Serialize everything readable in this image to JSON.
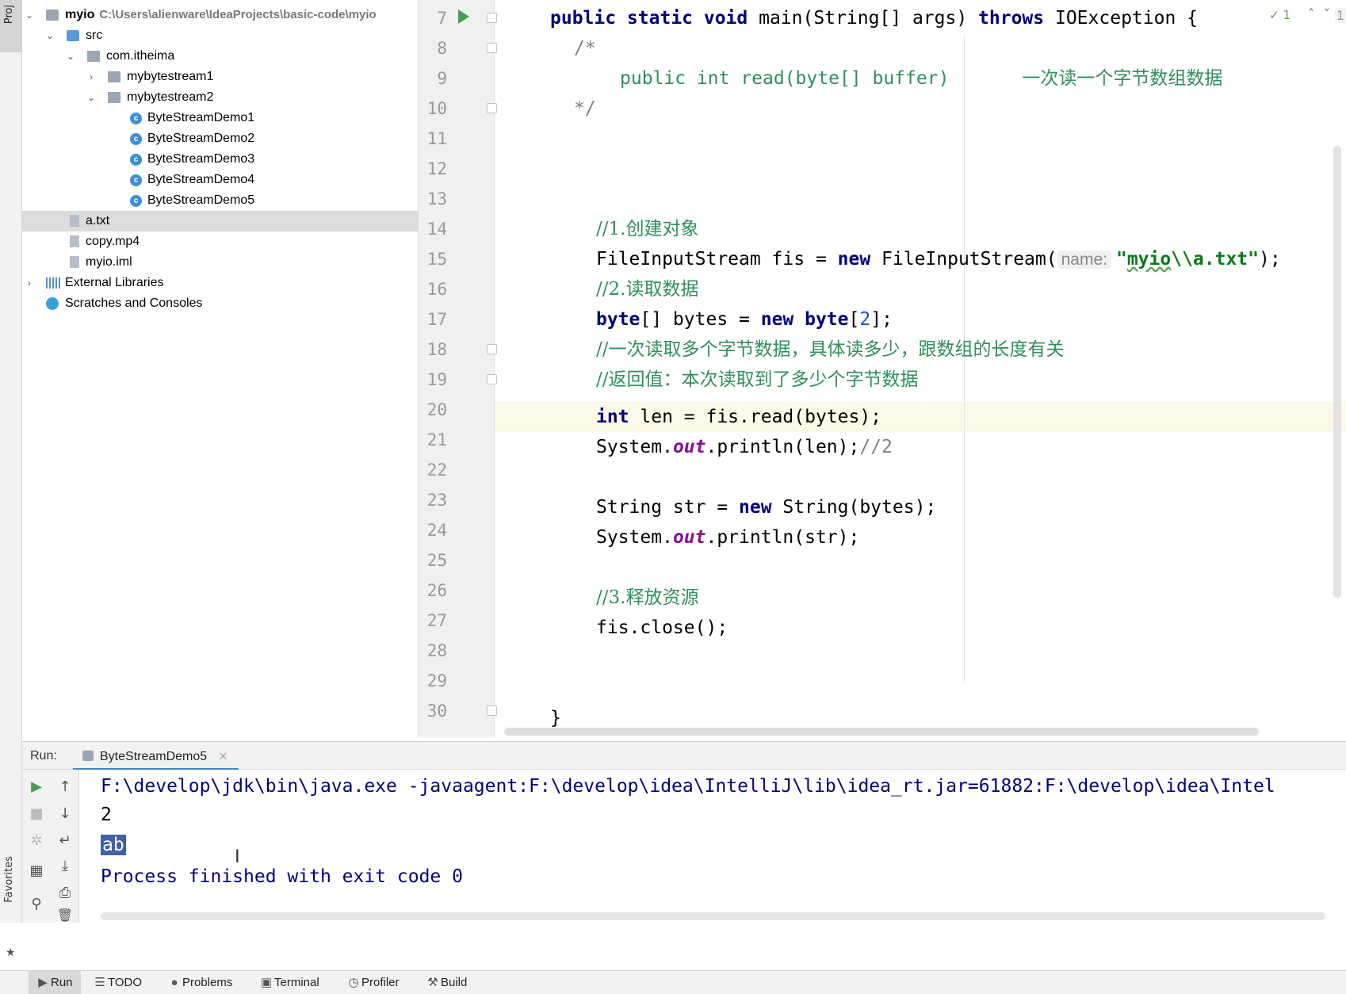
{
  "left_strip": {
    "project_label": "Proj",
    "favorites_label": "Favorites"
  },
  "project_tree": {
    "rows": [
      {
        "label": "myio",
        "path": "C:\\Users\\alienware\\IdeaProjects\\basic-code\\myio"
      },
      {
        "label": "src"
      },
      {
        "label": "com.itheima"
      },
      {
        "label": "mybytestream1"
      },
      {
        "label": "mybytestream2"
      },
      {
        "label": "ByteStreamDemo1"
      },
      {
        "label": "ByteStreamDemo2"
      },
      {
        "label": "ByteStreamDemo3"
      },
      {
        "label": "ByteStreamDemo4"
      },
      {
        "label": "ByteStreamDemo5"
      },
      {
        "label": "a.txt"
      },
      {
        "label": "copy.mp4"
      },
      {
        "label": "myio.iml"
      },
      {
        "label": "External Libraries"
      },
      {
        "label": "Scratches and Consoles"
      }
    ],
    "selected": "a.txt"
  },
  "editor": {
    "line_numbers": [
      "7",
      "8",
      "9",
      "10",
      "11",
      "12",
      "13",
      "14",
      "15",
      "16",
      "17",
      "18",
      "19",
      "20",
      "21",
      "22",
      "23",
      "24",
      "25",
      "26",
      "27",
      "28",
      "29",
      "30"
    ],
    "current_line": "20",
    "inspection_count": "1",
    "right_edge": "1",
    "code": {
      "l7_kw": "public static void",
      "l7_rest": " main(String[] args) ",
      "l7_throws": "throws",
      "l7_end": " IOException {",
      "l8": "/*",
      "l9_sig": "public int read(byte[] buffer)",
      "l9_cn": "一次读一个字节数组数据",
      "l10": "*/",
      "l14": "//1.创建对象",
      "l15_a": "FileInputStream fis = ",
      "l15_new": "new",
      "l15_b": " FileInputStream(",
      "l15_hint": "name:",
      "l15_str_q": "\"",
      "l15_str_sq": "myio",
      "l15_str_rest": "\\\\a.txt\"",
      "l15_end": ");",
      "l16": "//2.读取数据",
      "l17_type": "byte",
      "l17_a": "[] bytes = ",
      "l17_new": "new",
      "l17_type2": " byte",
      "l17_b": "[",
      "l17_num": "2",
      "l17_c": "];",
      "l18": "//一次读取多个字节数据，具体读多少，跟数组的长度有关",
      "l19": "//返回值：本次读取到了多少个字节数据",
      "l20_kw": "int",
      "l20_rest": " len = fis.read(bytes);",
      "l21_a": "System.",
      "l21_out": "out",
      "l21_b": ".println(len);",
      "l21_cm": "//2",
      "l23_a": "String str = ",
      "l23_new": "new",
      "l23_b": " String(bytes);",
      "l24_a": "System.",
      "l24_out": "out",
      "l24_b": ".println(str);",
      "l26": "//3.释放资源",
      "l27": "fis.close();",
      "l30": "}"
    }
  },
  "run_panel": {
    "label": "Run:",
    "tab": "ByteStreamDemo5",
    "console": {
      "command": "F:\\develop\\jdk\\bin\\java.exe -javaagent:F:\\develop\\idea\\IntelliJ\\lib\\idea_rt.jar=61882:F:\\develop\\idea\\Intel",
      "output1": "2",
      "output2": "ab",
      "exit": "Process finished with exit code 0"
    }
  },
  "bottom_bar": {
    "run": "Run",
    "todo": "TODO",
    "problems": "Problems",
    "terminal": "Terminal",
    "profiler": "Profiler",
    "build": "Build"
  }
}
